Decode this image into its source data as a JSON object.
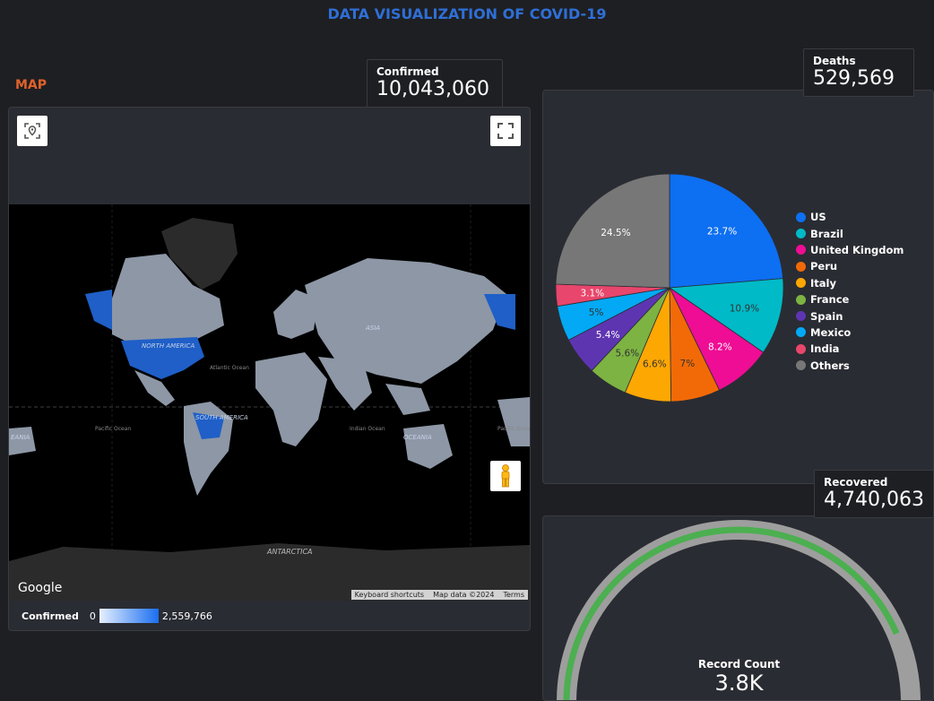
{
  "page": {
    "title": "DATA VISUALIZATION OF COVID-19",
    "map_label": "MAP"
  },
  "kpis": {
    "confirmed": {
      "label": "Confirmed",
      "value": "10,043,060"
    },
    "deaths": {
      "label": "Deaths",
      "value": "529,569"
    },
    "recovered": {
      "label": "Recovered",
      "value": "4,740,063"
    }
  },
  "map": {
    "labels": [
      "NORTH AMERICA",
      "SOUTH AMERICA",
      "ASIA",
      "Atlantic Ocean",
      "Pacific Ocean",
      "Indian Ocean",
      "OCEANIA",
      "ANTARCTICA"
    ],
    "google_logo": "Google",
    "attribution": {
      "shortcuts": "Keyboard shortcuts",
      "map_data": "Map data ©2024",
      "terms": "Terms"
    },
    "legend": {
      "label": "Confirmed",
      "min": "0",
      "max": "2,559,766"
    },
    "highlight_color": "#1f5fc7",
    "land_color": "#8d97a6",
    "icons": [
      "locate-icon",
      "fullscreen-icon",
      "pegman-icon",
      "zoom-in-icon",
      "zoom-out-icon"
    ]
  },
  "chart_data": {
    "type": "pie",
    "categories": [
      "US",
      "Brazil",
      "United Kingdom",
      "Peru",
      "Italy",
      "France",
      "Spain",
      "Mexico",
      "India",
      "Others"
    ],
    "values": [
      23.7,
      10.9,
      8.2,
      7,
      6.6,
      5.6,
      5.4,
      5,
      3.1,
      24.5
    ],
    "value_labels": [
      "23.7%",
      "10.9%",
      "8.2%",
      "7%",
      "6.6%",
      "5.6%",
      "5.4%",
      "5%",
      "3.1%",
      "24.5%"
    ],
    "colors": [
      "#0d6ff2",
      "#00bac7",
      "#ee0d94",
      "#f26a07",
      "#fda703",
      "#7cb342",
      "#5e35b1",
      "#03a9f4",
      "#e8466c",
      "#777777"
    ],
    "legend_position": "right"
  },
  "gauge": {
    "label": "Record Count",
    "value": "3.8K",
    "fill_fraction": 0.87,
    "bar_color": "#4caf50",
    "track_color": "#9e9e9e"
  }
}
